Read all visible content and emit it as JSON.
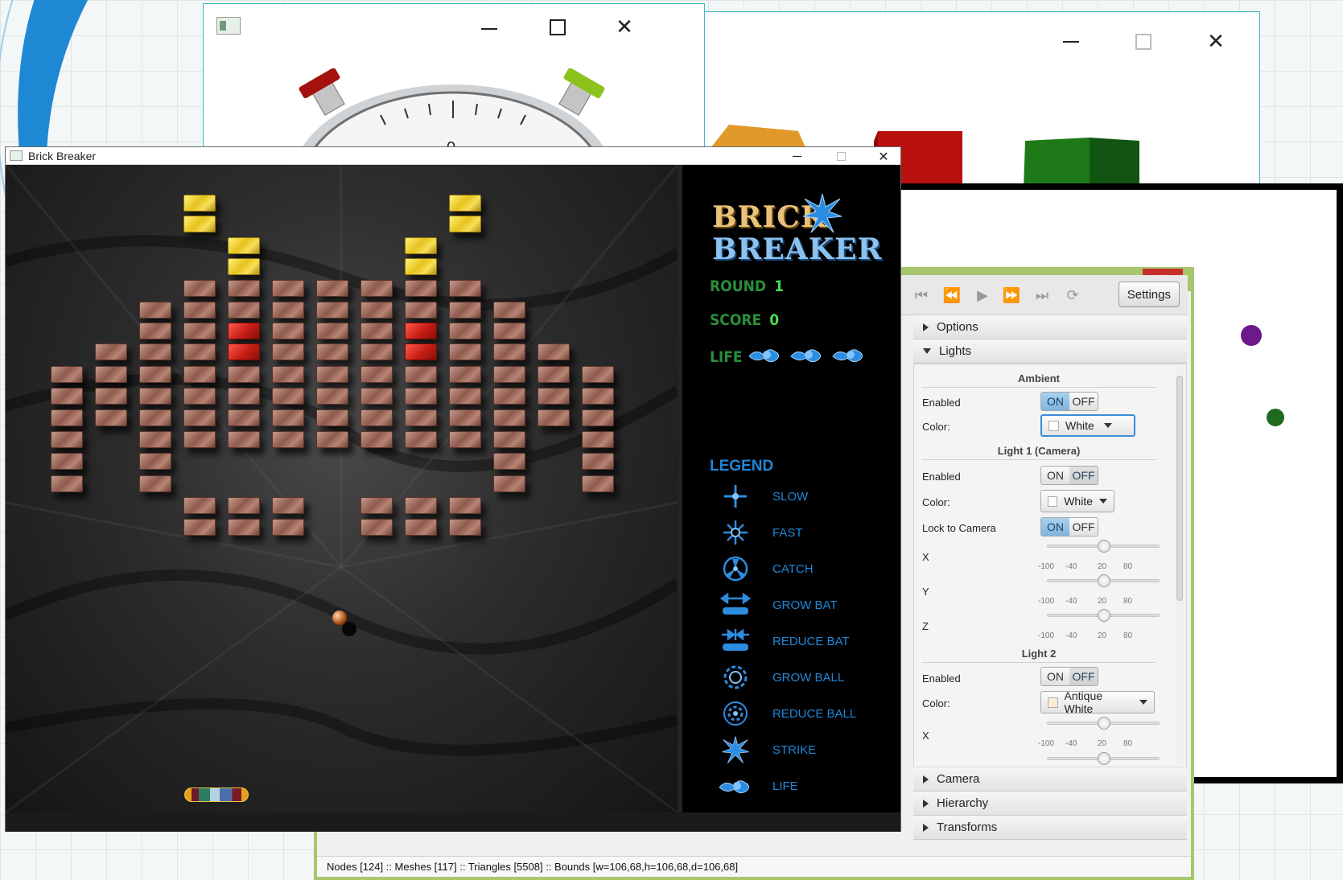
{
  "stopwatch_window": {
    "close_glyph": "✕",
    "dial_number": "0"
  },
  "cubes_window": {
    "close_glyph": "✕"
  },
  "viewer_window": {
    "toolbar": {
      "settings_label": "Settings"
    },
    "panels": {
      "options": "Options",
      "lights": "Lights",
      "camera": "Camera",
      "hierarchy": "Hierarchy",
      "transforms": "Transforms"
    },
    "ambient": {
      "title": "Ambient",
      "enabled_label": "Enabled",
      "enabled": "ON",
      "color_label": "Color:",
      "color_value": "White"
    },
    "light1": {
      "title": "Light 1 (Camera)",
      "enabled_label": "Enabled",
      "enabled": "OFF",
      "color_label": "Color:",
      "color_value": "White",
      "lock_label": "Lock to Camera",
      "lock": "ON",
      "x_label": "X",
      "y_label": "Y",
      "z_label": "Z"
    },
    "light2": {
      "title": "Light 2",
      "enabled_label": "Enabled",
      "enabled": "OFF",
      "color_label": "Color:",
      "color_value": "Antique White",
      "x_label": "X"
    },
    "toggle_on": "ON",
    "toggle_off": "OFF",
    "slider_ticks": [
      "-100",
      "-40",
      "20",
      "80"
    ],
    "status": "Nodes [124] :: Meshes [117] :: Triangles [5508] :: Bounds [w=106,68,h=106,68,d=106,68]"
  },
  "brick_breaker": {
    "title": "Brick Breaker",
    "logo_line1": "BRICK",
    "logo_line2": "BREAKER",
    "round_label": "ROUND",
    "round_value": "1",
    "score_label": "SCORE",
    "score_value": "0",
    "life_label": "LIFE",
    "lives": 3,
    "legend_title": "LEGEND",
    "legend": [
      {
        "label": "SLOW",
        "icon": "slow-icon"
      },
      {
        "label": "FAST",
        "icon": "fast-icon"
      },
      {
        "label": "CATCH",
        "icon": "catch-icon"
      },
      {
        "label": "GROW BAT",
        "icon": "grow-bat-icon"
      },
      {
        "label": "REDUCE BAT",
        "icon": "reduce-bat-icon"
      },
      {
        "label": "GROW BALL",
        "icon": "grow-ball-icon"
      },
      {
        "label": "REDUCE BALL",
        "icon": "reduce-ball-icon"
      },
      {
        "label": "STRIKE",
        "icon": "strike-icon"
      },
      {
        "label": "LIFE",
        "icon": "life-icon"
      }
    ]
  },
  "colors": {
    "legend_blue": "#1f87d8",
    "hud_green": "#2a8f39",
    "viewer_frame": "#a6c76b",
    "window_accent": "#46b6c9"
  }
}
